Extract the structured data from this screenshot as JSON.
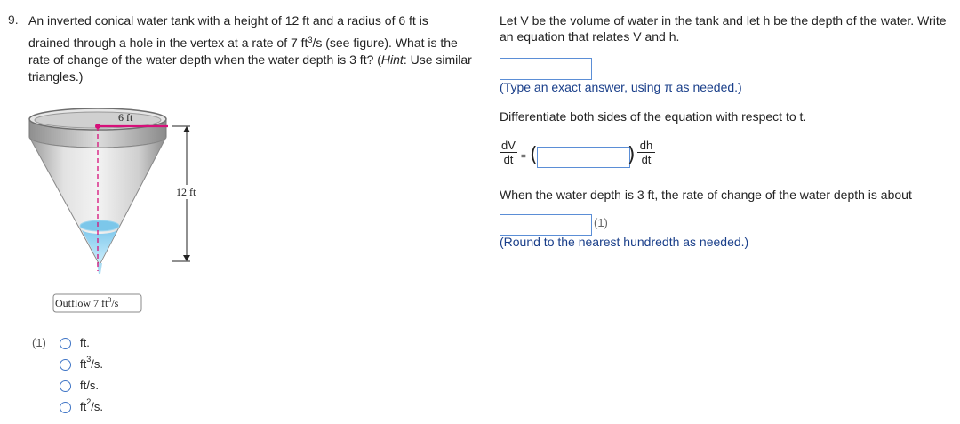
{
  "question": {
    "number": "9.",
    "text_line1_part1": "An inverted conical water tank with a height of 12 ft and a radius of 6 ft is",
    "text_line2_part1": "drained through a hole in the vertex at a rate of 7 ft",
    "text_line2_sup": "3",
    "text_line2_part2": "/s (see figure). What is the",
    "text_line3": "rate of change of the water depth when the water depth is 3 ft? (",
    "hint_word": "Hint",
    "text_line3_end": ": Use similar",
    "text_line4": "triangles.)"
  },
  "figure": {
    "radius_label": "6 ft",
    "height_label": "12 ft",
    "outflow_label": "Outflow 7 ft",
    "outflow_sup": "3",
    "outflow_suffix": "/s"
  },
  "options": {
    "tag": "(1)",
    "items": [
      {
        "label": "ft.",
        "sup": "",
        "suffix": ""
      },
      {
        "label": "ft",
        "sup": "3",
        "suffix": "/s."
      },
      {
        "label": "ft/s.",
        "sup": "",
        "suffix": ""
      },
      {
        "label": "ft",
        "sup": "2",
        "suffix": "/s."
      }
    ]
  },
  "right": {
    "prompt": "Let V be the volume of water in the tank and let h be the depth of the water. Write an equation that relates V and h.",
    "answer1_value": "",
    "hint1": "(Type an exact answer, using π as needed.)",
    "differentiate": "Differentiate both sides of the equation with respect to t.",
    "dV": "dV",
    "dt": "dt",
    "dh": "dh",
    "equals": "=",
    "paren_open": "(",
    "paren_close": ")",
    "answer2_value": "",
    "when_text": "When the water depth is 3 ft, the rate of change of the water depth is about",
    "answer3_value": "",
    "dropdown_tag": "(1)",
    "hint2": "(Round to the nearest hundredth as needed.)"
  },
  "colors": {
    "link_blue": "#1a3f8a",
    "input_border": "#5b8ed6",
    "radio_border": "#3f75c6",
    "magenta": "#d6107a",
    "water": "#8fd0ee"
  }
}
